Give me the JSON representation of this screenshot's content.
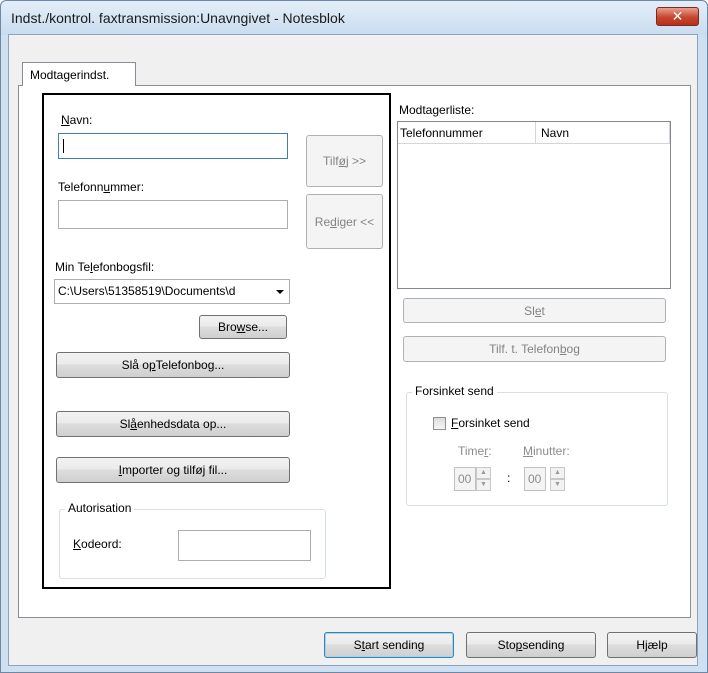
{
  "window": {
    "title": "Indst./kontrol. faxtransmission:Unavngivet - Notesblok",
    "close_glyph": "✕"
  },
  "tab": {
    "label": "Modtagerindst."
  },
  "form": {
    "name_label_u": "N",
    "name_label_rest": "avn:",
    "name_value": "",
    "phone_label_pre": "Telefonn",
    "phone_label_u": "u",
    "phone_label_post": "mmer:",
    "phone_value": "",
    "add_btn_pre": "Tilf",
    "add_btn_u": "ø",
    "add_btn_post": "j >>",
    "edit_btn_pre": "Re",
    "edit_btn_u": "d",
    "edit_btn_post": "iger <<",
    "phonebook_label_pre": "Min Te",
    "phonebook_label_u": "l",
    "phonebook_label_post": "efonbogsfil:",
    "phonebook_path": "C:\\Users\\51358519\\Documents\\d",
    "browse_pre": "Bro",
    "browse_u": "w",
    "browse_post": "se...",
    "lookup_phonebook_pre": "Slå o",
    "lookup_phonebook_u": "p",
    "lookup_phonebook_post": " Telefonbog...",
    "lookup_device_pre": "Sl",
    "lookup_device_u": "å",
    "lookup_device_post": " enhedsdata op...",
    "import_u": "I",
    "import_post": "mporter og tilføj fil...",
    "auth_title": "Autorisation",
    "password_label_u": "K",
    "password_label_post": "odeord:",
    "password_value": ""
  },
  "recipients": {
    "label_pre": "Modta",
    "label_u": "g",
    "label_post": "erliste:",
    "columns": [
      "Telefonnummer",
      "Navn"
    ],
    "delete_pre": "Sl",
    "delete_u": "e",
    "delete_post": "t",
    "to_phonebook_pre": "Tilf. t. Telefon ",
    "to_phonebook_u": "b",
    "to_phonebook_post": "og"
  },
  "delayed": {
    "group_title": "Forsinket send",
    "checkbox_u": "F",
    "checkbox_post": "orsinket send",
    "checked": false,
    "hours_label_pre": "Time",
    "hours_label_u": "r",
    "hours_label_post": ":",
    "minutes_label_u": "M",
    "minutes_label_post": "inutter:",
    "hours_value": "00",
    "colon": ":",
    "minutes_value": "00"
  },
  "footer": {
    "start_pre": "S",
    "start_u": "t",
    "start_post": "art sending",
    "stop_pre": "Sto",
    "stop_u": "p",
    "stop_post": " sending",
    "help": "Hjælp"
  }
}
